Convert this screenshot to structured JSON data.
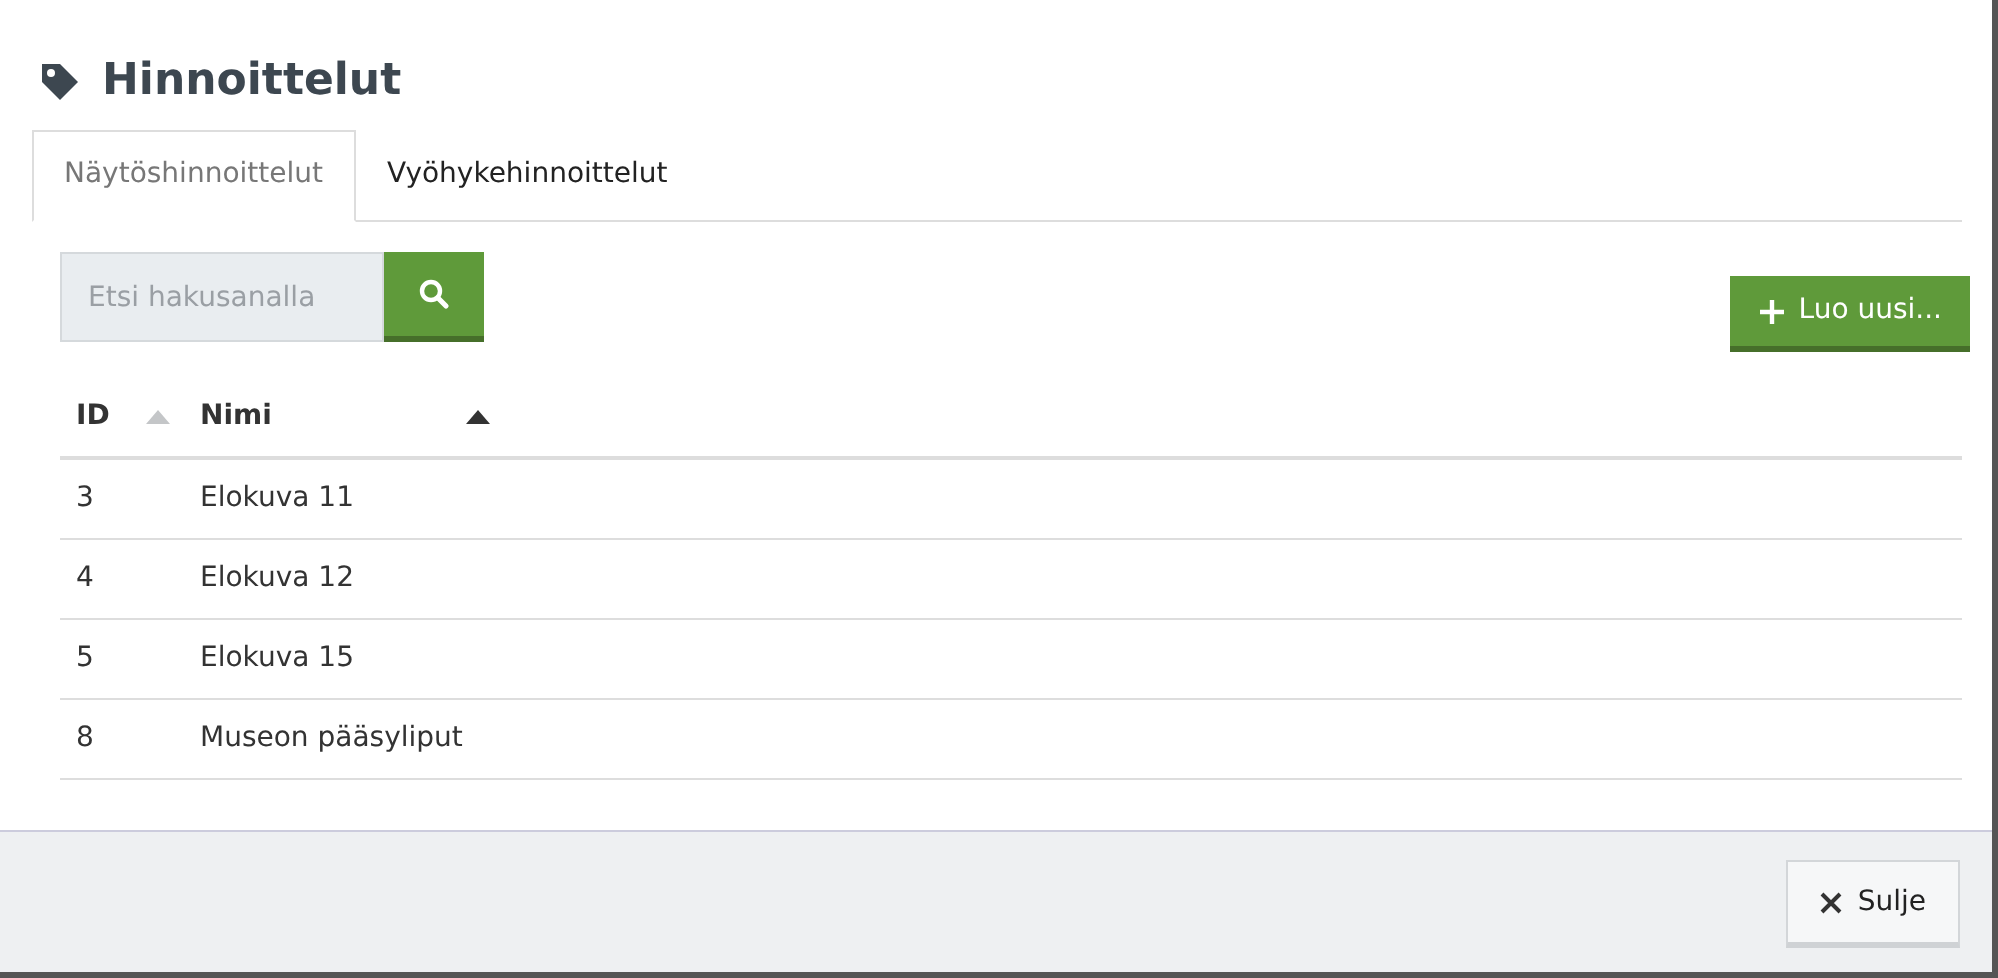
{
  "title": "Hinnoittelut",
  "tabs": [
    {
      "label": "Näytöshinnoittelut",
      "selected": true
    },
    {
      "label": "Vyöhykehinnoittelut",
      "selected": false
    }
  ],
  "search": {
    "placeholder": "Etsi hakusanalla"
  },
  "create_button": "Luo uusi...",
  "table": {
    "columns": [
      {
        "label": "ID",
        "sorted": false
      },
      {
        "label": "Nimi",
        "sorted": true
      }
    ],
    "rows": [
      [
        "3",
        "Elokuva 11"
      ],
      [
        "4",
        "Elokuva 12"
      ],
      [
        "5",
        "Elokuva 15"
      ],
      [
        "8",
        "Museon pääsyliput"
      ]
    ]
  },
  "close_button": "Sulje"
}
